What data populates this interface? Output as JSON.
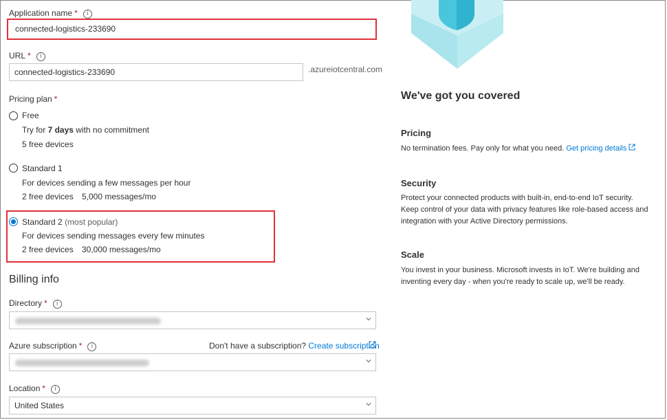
{
  "form": {
    "app_name": {
      "label": "Application name",
      "required": "*",
      "value": "connected-logistics-233690"
    },
    "url": {
      "label": "URL",
      "required": "*",
      "value": "connected-logistics-233690",
      "suffix": ".azureiotcentral.com"
    },
    "pricing": {
      "label": "Pricing plan",
      "required": "*",
      "plans": [
        {
          "name": "Free",
          "desc_pre": "Try for ",
          "desc_bold": "7 days",
          "desc_post": " with no commitment",
          "devices": "5 free devices",
          "messages": "",
          "selected": false
        },
        {
          "name": "Standard 1",
          "tag": "",
          "desc": "For devices sending a few messages per hour",
          "devices": "2 free devices",
          "messages": "5,000 messages/mo",
          "selected": false
        },
        {
          "name": "Standard 2",
          "tag": "(most popular)",
          "desc": "For devices sending messages every few minutes",
          "devices": "2 free devices",
          "messages": "30,000 messages/mo",
          "selected": true
        }
      ]
    },
    "billing": {
      "heading": "Billing info",
      "directory": {
        "label": "Directory",
        "required": "*"
      },
      "subscription": {
        "label": "Azure subscription",
        "required": "*",
        "no_sub_text": "Don't have a subscription?",
        "create_link": "Create subscription"
      },
      "location": {
        "label": "Location",
        "required": "*",
        "value": "United States"
      }
    }
  },
  "side": {
    "heading": "We've got you covered",
    "pricing": {
      "title": "Pricing",
      "text": "No termination fees. Pay only for what you need.",
      "link": "Get pricing details"
    },
    "security": {
      "title": "Security",
      "text": "Protect your connected products with built-in, end-to-end IoT security. Keep control of your data with privacy features like role-based access and integration with your Active Directory permissions."
    },
    "scale": {
      "title": "Scale",
      "text": "You invest in your business. Microsoft invests in IoT. We're building and inventing every day - when you're ready to scale up, we'll be ready."
    }
  },
  "colors": {
    "accent": "#0078d4",
    "highlight": "#e0303a",
    "required": "#a4262c"
  },
  "icons": [
    "info-icon",
    "chevron-down-icon",
    "external-link-icon",
    "shield-illustration"
  ]
}
